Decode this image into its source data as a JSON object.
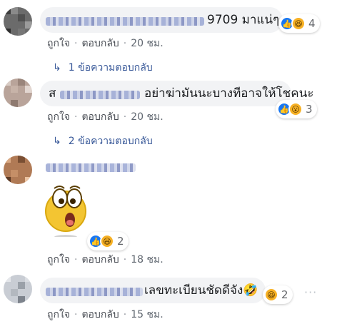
{
  "comments": [
    {
      "text": "9709 มาแน่ๆ",
      "reaction_count": "4",
      "actions": {
        "like": "ถูกใจ",
        "reply": "ตอบกลับ",
        "time": "20 ชม."
      },
      "replies_label": "1 ข้อความตอบกลับ"
    },
    {
      "text": "อย่าฆ่ามันนะบางทีอาจให้โชคนะ",
      "prefix": "ส",
      "reaction_count": "3",
      "actions": {
        "like": "ถูกใจ",
        "reply": "ตอบกลับ",
        "time": "20 ชม."
      },
      "replies_label": "2 ข้อความตอบกลับ"
    },
    {
      "reaction_count": "2",
      "actions": {
        "like": "ถูกใจ",
        "reply": "ตอบกลับ",
        "time": "18 ชม."
      }
    },
    {
      "text": "เลขทะเบียนชัดดีจัง🤣",
      "reaction_count": "2",
      "actions": {
        "like": "ถูกใจ",
        "reply": "ตอบกลับ",
        "time": "15 ชม."
      }
    }
  ],
  "separator": "·",
  "more_options": "···",
  "icons": {
    "like": "like-icon",
    "haha": "haha-icon",
    "wow": "wow-icon",
    "reply_arrow": "reply-arrow-icon"
  },
  "colors": {
    "bubble": "#f2f3f5",
    "link": "#385898",
    "like_blue": "#1877f2",
    "meta": "#606770"
  }
}
